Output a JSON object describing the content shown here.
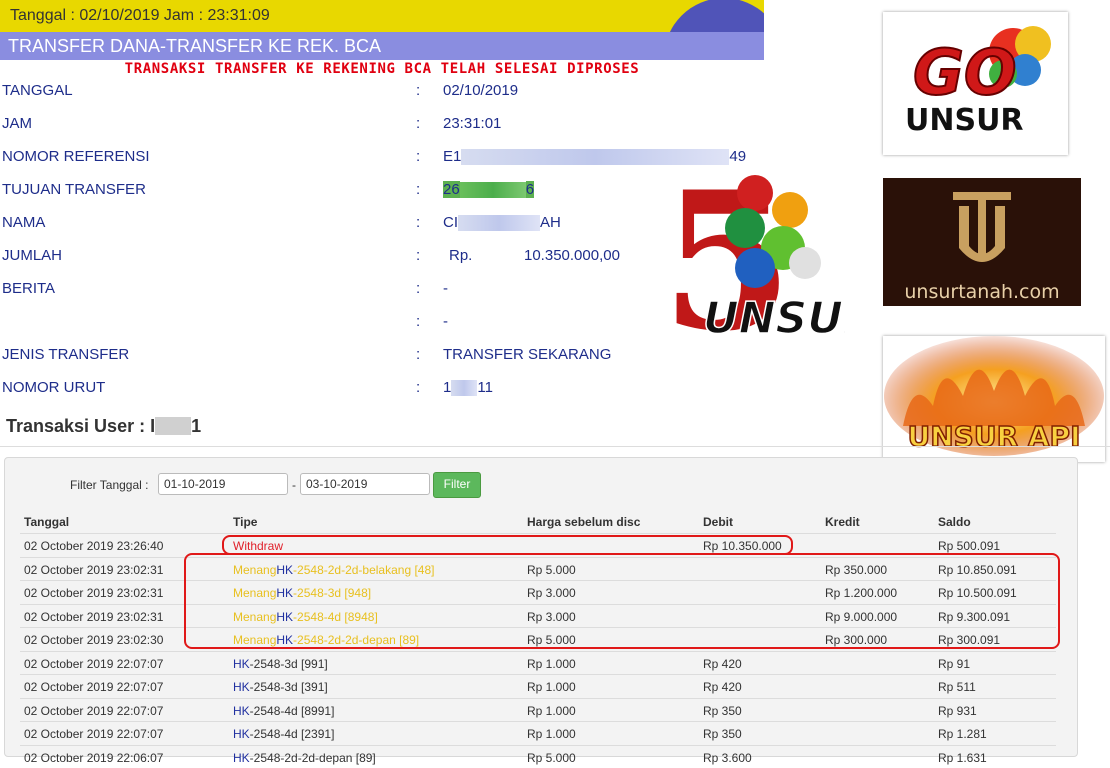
{
  "receipt": {
    "header_date": "Tanggal : 02/10/2019 Jam : 23:31:09",
    "title": "TRANSFER DANA-TRANSFER KE REK. BCA",
    "status": "TRANSAKSI TRANSFER KE REKENING BCA TELAH SELESAI DIPROSES",
    "separator": ":",
    "fields": {
      "tanggal": {
        "label": "TANGGAL",
        "value": "02/10/2019"
      },
      "jam": {
        "label": "JAM",
        "value": "23:31:01"
      },
      "nomor_referensi": {
        "label": "NOMOR REFERENSI",
        "value_start": "E1",
        "value_end": "49"
      },
      "tujuan_transfer": {
        "label": "TUJUAN TRANSFER",
        "value_start": "26",
        "value_end": "6"
      },
      "nama": {
        "label": "NAMA",
        "value_start": "CI",
        "value_end": "AH"
      },
      "jumlah": {
        "label": "JUMLAH",
        "currency": "Rp.",
        "value": "10.350.000,00"
      },
      "berita": {
        "label": "BERITA",
        "value": "-",
        "value2": "-"
      },
      "jenis_transfer": {
        "label": "JENIS TRANSFER",
        "value": "TRANSFER SEKARANG"
      },
      "nomor_urut": {
        "label": "NOMOR URUT",
        "value_start": "1",
        "value_end": "11"
      }
    }
  },
  "logos": {
    "gounsur": {
      "text_top": "GO",
      "text_bottom": "UNSUR"
    },
    "five_unsur": {
      "numeral": "5",
      "text": "UNSUR"
    },
    "unsurtanah": {
      "monogram": "U",
      "text": "unsurtanah.com"
    },
    "unsurapi": {
      "text": "UNSUR API"
    }
  },
  "transactions": {
    "title_prefix": "Transaksi User : I",
    "title_suffix": "1",
    "filter": {
      "label": "Filter Tanggal :",
      "from": "01-10-2019",
      "separator": "-",
      "to": "03-10-2019",
      "button": "Filter"
    },
    "columns": {
      "tanggal": "Tanggal",
      "tipe": "Tipe",
      "harga": "Harga sebelum disc",
      "debit": "Debit",
      "kredit": "Kredit",
      "saldo": "Saldo"
    },
    "rows": [
      {
        "date": "02 October 2019 23:26:40",
        "kind": "withdraw",
        "tipe": "Withdraw",
        "harga": "",
        "debit": "Rp 10.350.000",
        "kredit": "",
        "saldo": "Rp 500.091"
      },
      {
        "date": "02 October 2019 23:02:31",
        "kind": "win",
        "prefix": "Menang",
        "hk": "HK",
        "rest": "-2548-2d-2d-belakang [48]",
        "harga": "Rp 5.000",
        "debit": "",
        "kredit": "Rp 350.000",
        "saldo": "Rp 10.850.091"
      },
      {
        "date": "02 October 2019 23:02:31",
        "kind": "win",
        "prefix": "Menang",
        "hk": "HK",
        "rest": "-2548-3d [948]",
        "harga": "Rp 3.000",
        "debit": "",
        "kredit": "Rp 1.200.000",
        "saldo": "Rp 10.500.091"
      },
      {
        "date": "02 October 2019 23:02:31",
        "kind": "win",
        "prefix": "Menang",
        "hk": "HK",
        "rest": "-2548-4d [8948]",
        "harga": "Rp 3.000",
        "debit": "",
        "kredit": "Rp 9.000.000",
        "saldo": "Rp 9.300.091"
      },
      {
        "date": "02 October 2019 23:02:30",
        "kind": "win",
        "prefix": "Menang",
        "hk": "HK",
        "rest": "-2548-2d-2d-depan [89]",
        "harga": "Rp 5.000",
        "debit": "",
        "kredit": "Rp 300.000",
        "saldo": "Rp 300.091"
      },
      {
        "date": "02 October 2019 22:07:07",
        "kind": "bet",
        "prefix": "",
        "hk": "HK",
        "rest": "-2548-3d [991]",
        "harga": "Rp 1.000",
        "debit": "Rp 420",
        "kredit": "",
        "saldo": "Rp 91"
      },
      {
        "date": "02 October 2019 22:07:07",
        "kind": "bet",
        "prefix": "",
        "hk": "HK",
        "rest": "-2548-3d [391]",
        "harga": "Rp 1.000",
        "debit": "Rp 420",
        "kredit": "",
        "saldo": "Rp 511"
      },
      {
        "date": "02 October 2019 22:07:07",
        "kind": "bet",
        "prefix": "",
        "hk": "HK",
        "rest": "-2548-4d [8991]",
        "harga": "Rp 1.000",
        "debit": "Rp 350",
        "kredit": "",
        "saldo": "Rp 931"
      },
      {
        "date": "02 October 2019 22:07:07",
        "kind": "bet",
        "prefix": "",
        "hk": "HK",
        "rest": "-2548-4d [2391]",
        "harga": "Rp 1.000",
        "debit": "Rp 350",
        "kredit": "",
        "saldo": "Rp 1.281"
      },
      {
        "date": "02 October 2019 22:06:07",
        "kind": "bet",
        "prefix": "",
        "hk": "HK",
        "rest": "-2548-2d-2d-depan [89]",
        "harga": "Rp 5.000",
        "debit": "Rp 3.600",
        "kredit": "",
        "saldo": "Rp 1.631"
      }
    ]
  },
  "colors": {
    "header_yellow": "#e8d800",
    "header_purple": "#8a8de0",
    "status_red": "#e00010",
    "label_blue": "#1e2d8a",
    "win_yellow": "#e8c020",
    "highlight_red": "#e01818",
    "filter_green": "#5cb85c"
  }
}
